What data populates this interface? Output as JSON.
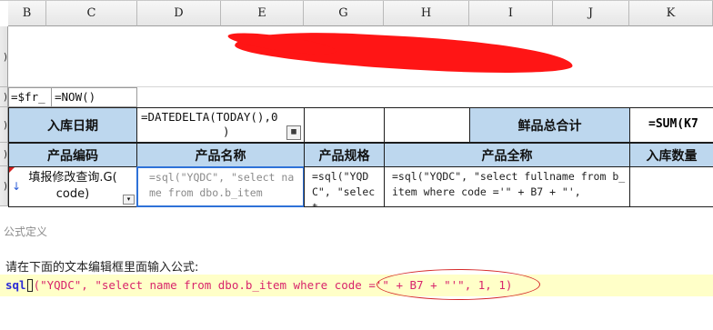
{
  "columns": [
    "B",
    "C",
    "D",
    "E",
    "G",
    "H",
    "I",
    "J",
    "K"
  ],
  "rows": {
    "r1_label": ")",
    "r2_label": ")",
    "r3_label": ")",
    "r4_label": ")",
    "r5_label": ")"
  },
  "cells": {
    "b2": "=$fr_",
    "c2": "=NOW()",
    "r3_label_col": "入库日期",
    "r3_formula": "=DATEDELTA(TODAY(),0",
    "r3_formula_cont": ")",
    "r3_total_label": "鲜品总合计",
    "r3_sum": "=SUM(K7",
    "h_product_code": "产品编码",
    "h_product_name": "产品名称",
    "h_product_spec": "产品规格",
    "h_product_fullname": "产品全称",
    "h_in_qty": "入库数量",
    "r5_code_line1": "填报修改查询.G(",
    "r5_code_line2": "code)",
    "r5_name_formula": "=sql(\"YQDC\", \"select name from dbo.b_item",
    "r5_spec_formula": "=sql(\"YQD C\", \"select",
    "r5_full_formula": "=sql(\"YQDC\", \"select fullname from b_item where code ='\" + B7 + \"',"
  },
  "formula_panel": {
    "title": "公式定义",
    "prompt": "请在下面的文本编辑框里面输入公式:",
    "fn": "sql",
    "open": "(",
    "rest": "\"YQDC\", \"select name from dbo.b_item where code ='\" + B7 + \"'\", 1, 1)"
  },
  "colors": {
    "header_blue": "#bdd7ee",
    "redaction": "#ff1515",
    "editor_bg": "#ffffc8",
    "highlight_oval": "#d62b2b"
  }
}
